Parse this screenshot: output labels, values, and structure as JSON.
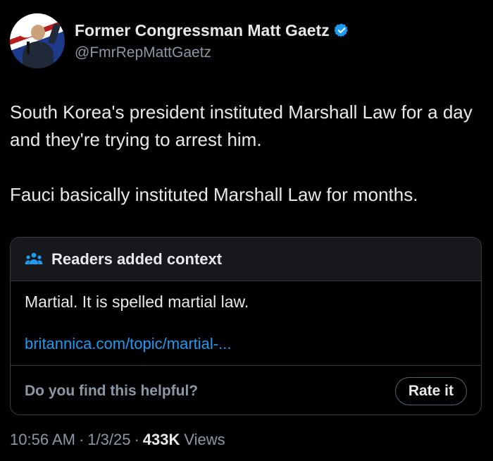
{
  "author": {
    "display_name": "Former Congressman Matt Gaetz",
    "handle": "@FmrRepMattGaetz",
    "verified_icon": "verified-badge-icon"
  },
  "tweet": {
    "paragraphs": [
      "South Korea's president instituted Marshall Law for a day and they're trying to arrest him.",
      "Fauci basically instituted Marshall Law for months."
    ]
  },
  "community_note": {
    "title": "Readers added context",
    "icon": "people-icon",
    "text": "Martial.  It is spelled martial law.",
    "link": "britannica.com/topic/martial-...",
    "helpful_question": "Do you find this helpful?",
    "rate_button": "Rate it"
  },
  "meta": {
    "time": "10:56 AM",
    "separator": "·",
    "date": "1/3/25",
    "views_count": "433K",
    "views_label": "Views"
  },
  "colors": {
    "background": "#000000",
    "text": "#e7e9ea",
    "muted": "#8b98a5",
    "link": "#1d9bf0",
    "verified": "#1d9bf0"
  }
}
